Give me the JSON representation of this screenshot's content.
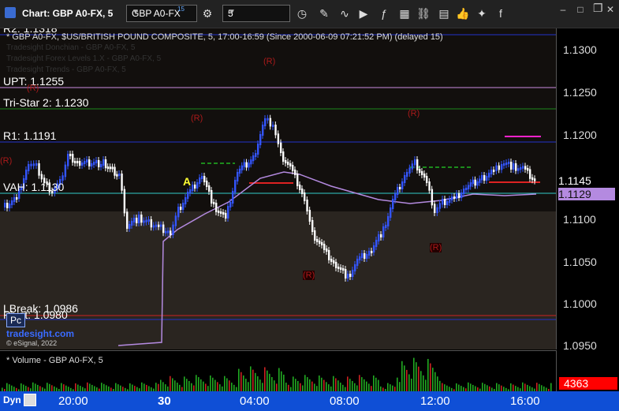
{
  "window": {
    "title": "Chart: GBP A0-FX, 5"
  },
  "toolbar": {
    "symbol": "GBP A0-FX",
    "symbol_superscript": "15",
    "interval": "5"
  },
  "chart": {
    "header": "* GBP A0-FX, $US/BRITISH POUND COMPOSITE, 5, 17:00-16:59 (Since 2000-06-09 07:21:52 PM) (delayed 15)",
    "faded_lines": [
      "Tradesight Donchian - GBP A0-FX, 5",
      "Tradesight Forex Levels 1.X - GBP A0-FX, 5",
      "Tradesight Trends - GBP A0-FX, 5"
    ],
    "levels": {
      "r2": "R2: 1.1318",
      "upt": "UPT: 1.1255",
      "tristar": "Tri-Star 2: 1.1230",
      "r1": "R1: 1.1191",
      "vah": "VAH: 1.1130",
      "lbreak": "LBreak: 1.0986",
      "pivot": "Pivot: 1.0980"
    },
    "brand": "tradesight.com",
    "copyright": "© eSignal, 2022",
    "pc_label": "Pc",
    "marker_a": "A",
    "r_markers": [
      "(R)",
      "(R)",
      "(R)",
      "(R)",
      "(R)",
      "(R)",
      "(R)"
    ]
  },
  "price_axis": {
    "labels": [
      "1.1300",
      "1.1250",
      "1.1200",
      "1.1145",
      "1.1100",
      "1.1050",
      "1.1000",
      "1.0950"
    ],
    "last_price": "1.1129",
    "target_price": "1.1145"
  },
  "volume": {
    "header": "* Volume - GBP A0-FX, 5",
    "last": "4363"
  },
  "time_axis": {
    "dyn": "Dyn",
    "labels": [
      "20:00",
      "30",
      "04:00",
      "08:00",
      "12:00",
      "16:00"
    ]
  },
  "colors": {
    "up": "#3355ff",
    "down": "#ffffff",
    "volume": "#22aa22",
    "vwap": "#b48ae0",
    "time_bg": "#0f4fd6"
  }
}
